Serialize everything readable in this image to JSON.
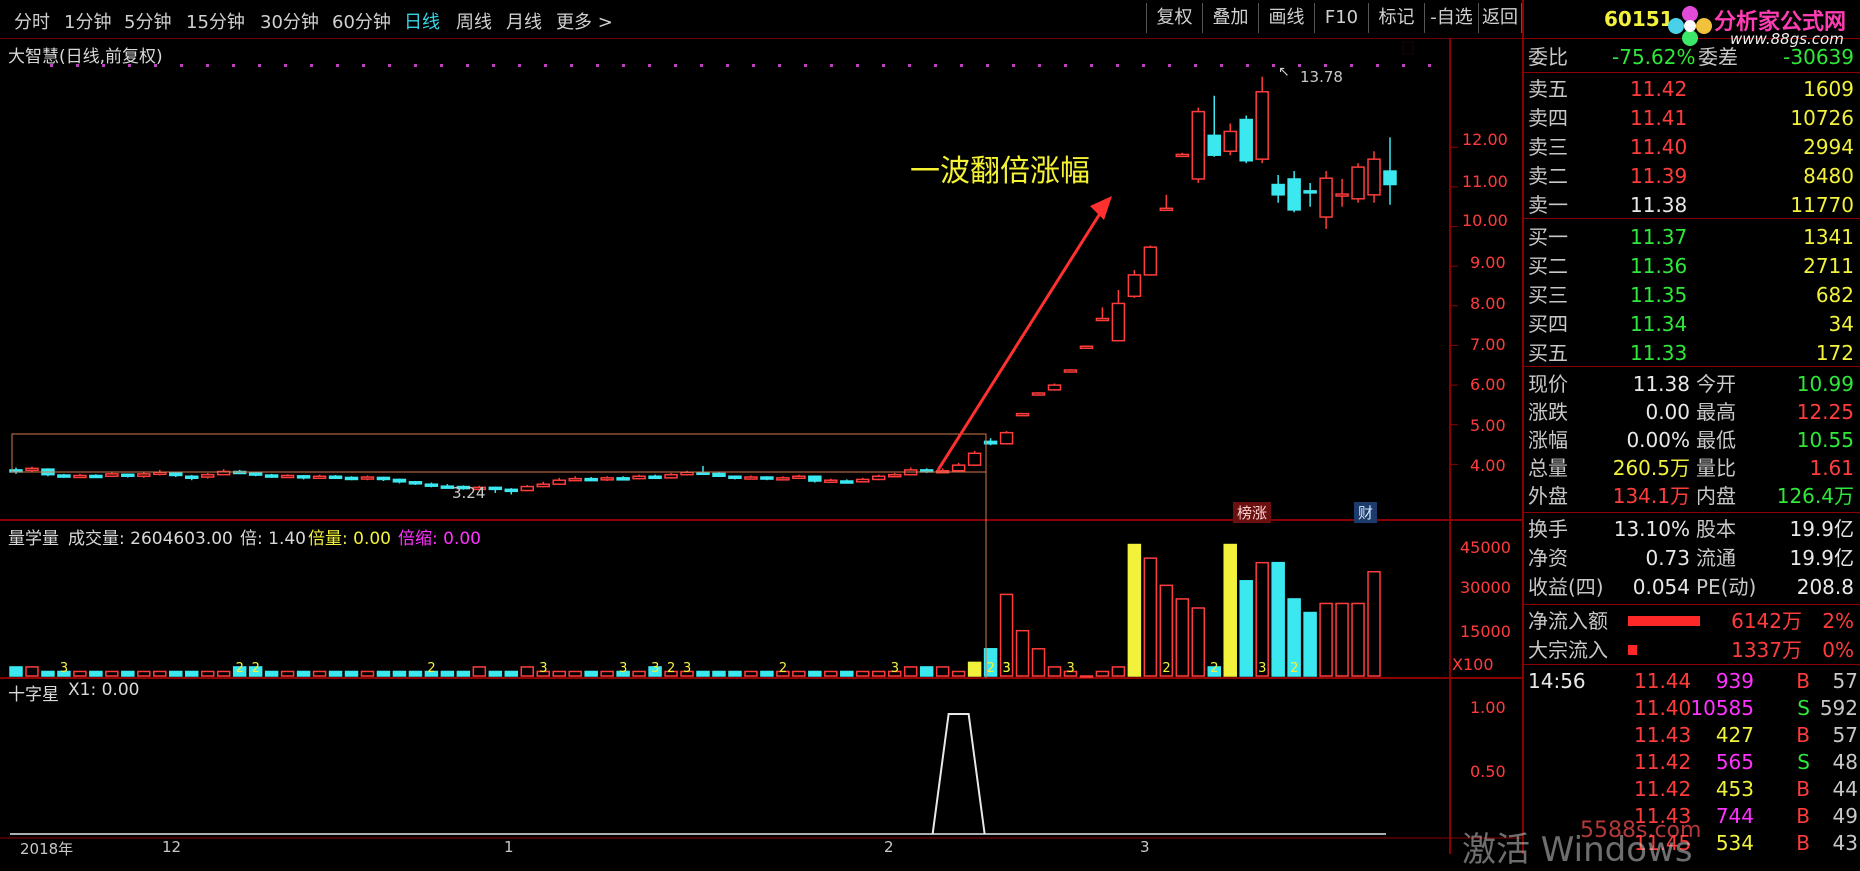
{
  "periods": [
    "分时",
    "1分钟",
    "5分钟",
    "15分钟",
    "30分钟",
    "60分钟",
    "日线",
    "周线",
    "月线",
    "更多 >"
  ],
  "active_period": "日线",
  "toolbar": [
    "复权",
    "叠加",
    "画线",
    "F10",
    "标记",
    "-自选",
    "返回"
  ],
  "stock_title": "大智慧(日线,前复权)",
  "annotation": "一波翻倍涨幅",
  "high_label": "13.78",
  "low_label": "3.24",
  "price_axis": [
    "12.00",
    "11.00",
    "10.00",
    "9.00",
    "8.00",
    "7.00",
    "6.00",
    "5.00",
    "4.00"
  ],
  "badges": {
    "bangzhang": "榜涨",
    "cai": "财"
  },
  "vol_header": {
    "name": "量学量",
    "vol_label": "成交量: 2604603.00",
    "bei_label": "倍: 1.40",
    "beiliang_label": "倍量: 0.00",
    "beisuo_label": "倍缩: 0.00"
  },
  "vol_axis": [
    "45000",
    "30000",
    "15000"
  ],
  "vol_unit": "X100",
  "vol_digits": [
    "3",
    "2",
    "2",
    "2",
    "3",
    "3",
    "3",
    "2",
    "3",
    "2",
    "3",
    "2",
    "2",
    "3",
    "3",
    "2",
    "2",
    "3",
    "2",
    "3"
  ],
  "ind_header": {
    "name": "十字星",
    "x1": "X1: 0.00"
  },
  "ind_axis": [
    "1.00",
    "0.50"
  ],
  "date_axis": [
    "2018年",
    "12",
    "1",
    "2",
    "3"
  ],
  "watermark": {
    "activate": "激活 Windows",
    "site": "5588s.com"
  },
  "panel": {
    "code": "60151",
    "logo_text": "分析家公式网",
    "logo_url": "www.88gs.com",
    "weibi_label": "委比",
    "weibi_value": "-75.62%",
    "weicha_label": "委差",
    "weicha_value": "-30639",
    "asks": [
      {
        "label": "卖五",
        "price": "11.42",
        "vol": "1609"
      },
      {
        "label": "卖四",
        "price": "11.41",
        "vol": "10726"
      },
      {
        "label": "卖三",
        "price": "11.40",
        "vol": "2994"
      },
      {
        "label": "卖二",
        "price": "11.39",
        "vol": "8480"
      },
      {
        "label": "卖一",
        "price": "11.38",
        "vol": "11770"
      }
    ],
    "bids": [
      {
        "label": "买一",
        "price": "11.37",
        "vol": "1341"
      },
      {
        "label": "买二",
        "price": "11.36",
        "vol": "2711"
      },
      {
        "label": "买三",
        "price": "11.35",
        "vol": "682"
      },
      {
        "label": "买四",
        "price": "11.34",
        "vol": "34"
      },
      {
        "label": "买五",
        "price": "11.33",
        "vol": "172"
      }
    ],
    "quote": [
      {
        "l1": "现价",
        "v1": "11.38",
        "c1": "white",
        "l2": "今开",
        "v2": "10.99",
        "c2": "green"
      },
      {
        "l1": "涨跌",
        "v1": "0.00",
        "c1": "white",
        "l2": "最高",
        "v2": "12.25",
        "c2": "red"
      },
      {
        "l1": "涨幅",
        "v1": "0.00%",
        "c1": "white",
        "l2": "最低",
        "v2": "10.55",
        "c2": "green"
      },
      {
        "l1": "总量",
        "v1": "260.5万",
        "c1": "yellow",
        "l2": "量比",
        "v2": "1.61",
        "c2": "red"
      },
      {
        "l1": "外盘",
        "v1": "134.1万",
        "c1": "red",
        "l2": "内盘",
        "v2": "126.4万",
        "c2": "green"
      }
    ],
    "stats": [
      {
        "l1": "换手",
        "v1": "13.10%",
        "l2": "股本",
        "v2": "19.9亿"
      },
      {
        "l1": "净资",
        "v1": "0.73",
        "l2": "流通",
        "v2": "19.9亿"
      },
      {
        "l1": "收益(四)",
        "v1": "0.054",
        "l2": "PE(动)",
        "v2": "208.8"
      }
    ],
    "flows": [
      {
        "label": "净流入额",
        "value": "6142万",
        "pct": "2%",
        "bar": 0.8
      },
      {
        "label": "大宗流入",
        "value": "1337万",
        "pct": "0%",
        "bar": 0.1
      }
    ],
    "ticks": [
      {
        "time": "14:56",
        "price": "11.44",
        "vol": "939",
        "side": "B",
        "n": "57",
        "vc": "magenta"
      },
      {
        "time": "",
        "price": "11.40",
        "vol": "10585",
        "side": "S",
        "n": "592",
        "vc": "magenta"
      },
      {
        "time": "",
        "price": "11.43",
        "vol": "427",
        "side": "B",
        "n": "57",
        "vc": "yellow"
      },
      {
        "time": "",
        "price": "11.42",
        "vol": "565",
        "side": "S",
        "n": "48",
        "vc": "magenta"
      },
      {
        "time": "",
        "price": "11.42",
        "vol": "453",
        "side": "B",
        "n": "44",
        "vc": "yellow"
      },
      {
        "time": "",
        "price": "11.43",
        "vol": "744",
        "side": "B",
        "n": "49",
        "vc": "magenta"
      },
      {
        "time": "",
        "price": "11.45",
        "vol": "534",
        "side": "B",
        "n": "43",
        "vc": "yellow"
      }
    ]
  },
  "chart_data": {
    "type": "candlestick",
    "price_axis_range": [
      3.0,
      14.0
    ],
    "series": [
      {
        "o": 3.86,
        "c": 3.82,
        "h": 3.92,
        "l": 3.76
      },
      {
        "o": 3.85,
        "c": 3.9,
        "h": 3.94,
        "l": 3.82
      },
      {
        "o": 3.88,
        "c": 3.74,
        "h": 3.9,
        "l": 3.7
      },
      {
        "o": 3.73,
        "c": 3.7,
        "h": 3.76,
        "l": 3.66
      },
      {
        "o": 3.71,
        "c": 3.72,
        "h": 3.76,
        "l": 3.68
      },
      {
        "o": 3.72,
        "c": 3.69,
        "h": 3.75,
        "l": 3.66
      },
      {
        "o": 3.7,
        "c": 3.76,
        "h": 3.8,
        "l": 3.68
      },
      {
        "o": 3.75,
        "c": 3.7,
        "h": 3.77,
        "l": 3.67
      },
      {
        "o": 3.7,
        "c": 3.76,
        "h": 3.8,
        "l": 3.66
      },
      {
        "o": 3.76,
        "c": 3.8,
        "h": 3.86,
        "l": 3.72
      },
      {
        "o": 3.79,
        "c": 3.72,
        "h": 3.82,
        "l": 3.68
      },
      {
        "o": 3.7,
        "c": 3.66,
        "h": 3.73,
        "l": 3.6
      },
      {
        "o": 3.68,
        "c": 3.74,
        "h": 3.78,
        "l": 3.64
      },
      {
        "o": 3.74,
        "c": 3.82,
        "h": 3.88,
        "l": 3.72
      },
      {
        "o": 3.82,
        "c": 3.79,
        "h": 3.86,
        "l": 3.76
      },
      {
        "o": 3.78,
        "c": 3.74,
        "h": 3.8,
        "l": 3.7
      },
      {
        "o": 3.73,
        "c": 3.7,
        "h": 3.76,
        "l": 3.66
      },
      {
        "o": 3.7,
        "c": 3.72,
        "h": 3.75,
        "l": 3.67
      },
      {
        "o": 3.71,
        "c": 3.66,
        "h": 3.73,
        "l": 3.62
      },
      {
        "o": 3.66,
        "c": 3.7,
        "h": 3.74,
        "l": 3.63
      },
      {
        "o": 3.7,
        "c": 3.68,
        "h": 3.73,
        "l": 3.64
      },
      {
        "o": 3.67,
        "c": 3.64,
        "h": 3.7,
        "l": 3.6
      },
      {
        "o": 3.64,
        "c": 3.68,
        "h": 3.72,
        "l": 3.6
      },
      {
        "o": 3.67,
        "c": 3.62,
        "h": 3.69,
        "l": 3.58
      },
      {
        "o": 3.62,
        "c": 3.56,
        "h": 3.64,
        "l": 3.52
      },
      {
        "o": 3.56,
        "c": 3.52,
        "h": 3.58,
        "l": 3.48
      },
      {
        "o": 3.5,
        "c": 3.46,
        "h": 3.54,
        "l": 3.42
      },
      {
        "o": 3.45,
        "c": 3.44,
        "h": 3.5,
        "l": 3.4
      },
      {
        "o": 3.44,
        "c": 3.4,
        "h": 3.47,
        "l": 3.36
      },
      {
        "o": 3.4,
        "c": 3.42,
        "h": 3.46,
        "l": 3.34
      },
      {
        "o": 3.42,
        "c": 3.38,
        "h": 3.44,
        "l": 3.28
      },
      {
        "o": 3.37,
        "c": 3.34,
        "h": 3.4,
        "l": 3.24
      },
      {
        "o": 3.34,
        "c": 3.44,
        "h": 3.48,
        "l": 3.32
      },
      {
        "o": 3.44,
        "c": 3.5,
        "h": 3.56,
        "l": 3.42
      },
      {
        "o": 3.5,
        "c": 3.6,
        "h": 3.66,
        "l": 3.48
      },
      {
        "o": 3.6,
        "c": 3.64,
        "h": 3.7,
        "l": 3.58
      },
      {
        "o": 3.64,
        "c": 3.62,
        "h": 3.68,
        "l": 3.58
      },
      {
        "o": 3.62,
        "c": 3.66,
        "h": 3.7,
        "l": 3.58
      },
      {
        "o": 3.66,
        "c": 3.64,
        "h": 3.7,
        "l": 3.6
      },
      {
        "o": 3.64,
        "c": 3.7,
        "h": 3.74,
        "l": 3.62
      },
      {
        "o": 3.7,
        "c": 3.66,
        "h": 3.74,
        "l": 3.64
      },
      {
        "o": 3.66,
        "c": 3.74,
        "h": 3.78,
        "l": 3.64
      },
      {
        "o": 3.74,
        "c": 3.8,
        "h": 3.84,
        "l": 3.72
      },
      {
        "o": 3.8,
        "c": 3.78,
        "h": 3.96,
        "l": 3.74
      },
      {
        "o": 3.77,
        "c": 3.7,
        "h": 3.8,
        "l": 3.68
      },
      {
        "o": 3.7,
        "c": 3.66,
        "h": 3.72,
        "l": 3.62
      },
      {
        "o": 3.66,
        "c": 3.68,
        "h": 3.72,
        "l": 3.62
      },
      {
        "o": 3.68,
        "c": 3.64,
        "h": 3.7,
        "l": 3.6
      },
      {
        "o": 3.64,
        "c": 3.66,
        "h": 3.7,
        "l": 3.6
      },
      {
        "o": 3.66,
        "c": 3.7,
        "h": 3.74,
        "l": 3.64
      },
      {
        "o": 3.7,
        "c": 3.58,
        "h": 3.72,
        "l": 3.54
      },
      {
        "o": 3.58,
        "c": 3.6,
        "h": 3.64,
        "l": 3.54
      },
      {
        "o": 3.58,
        "c": 3.56,
        "h": 3.62,
        "l": 3.52
      },
      {
        "o": 3.56,
        "c": 3.62,
        "h": 3.66,
        "l": 3.54
      },
      {
        "o": 3.62,
        "c": 3.7,
        "h": 3.74,
        "l": 3.6
      },
      {
        "o": 3.7,
        "c": 3.74,
        "h": 3.78,
        "l": 3.68
      },
      {
        "o": 3.74,
        "c": 3.86,
        "h": 3.92,
        "l": 3.72
      },
      {
        "o": 3.86,
        "c": 3.82,
        "h": 3.9,
        "l": 3.78
      },
      {
        "o": 3.82,
        "c": 3.84,
        "h": 3.9,
        "l": 3.8
      },
      {
        "o": 3.84,
        "c": 3.98,
        "h": 4.04,
        "l": 3.82
      },
      {
        "o": 3.98,
        "c": 4.28,
        "h": 4.34,
        "l": 3.96
      },
      {
        "o": 4.58,
        "c": 4.52,
        "h": 4.66,
        "l": 4.48
      },
      {
        "o": 4.52,
        "c": 4.8,
        "h": 4.84,
        "l": 4.5
      },
      {
        "o": 5.28,
        "c": 5.28,
        "h": 5.3,
        "l": 5.26
      },
      {
        "o": 5.8,
        "c": 5.8,
        "h": 5.82,
        "l": 5.78
      },
      {
        "o": 5.88,
        "c": 6.0,
        "h": 6.04,
        "l": 5.86
      },
      {
        "o": 6.38,
        "c": 6.38,
        "h": 6.4,
        "l": 6.36
      },
      {
        "o": 6.98,
        "c": 6.98,
        "h": 7.0,
        "l": 6.96
      },
      {
        "o": 7.68,
        "c": 7.68,
        "h": 7.96,
        "l": 7.66
      },
      {
        "o": 7.12,
        "c": 8.06,
        "h": 8.4,
        "l": 7.1
      },
      {
        "o": 8.24,
        "c": 8.78,
        "h": 8.9,
        "l": 8.2
      },
      {
        "o": 8.78,
        "c": 9.48,
        "h": 9.52,
        "l": 8.76
      },
      {
        "o": 10.46,
        "c": 10.46,
        "h": 10.8,
        "l": 10.44
      },
      {
        "o": 11.82,
        "c": 11.82,
        "h": 11.86,
        "l": 11.8
      },
      {
        "o": 11.2,
        "c": 12.9,
        "h": 13.0,
        "l": 11.1
      },
      {
        "o": 12.3,
        "c": 11.8,
        "h": 13.3,
        "l": 11.76
      },
      {
        "o": 11.9,
        "c": 12.4,
        "h": 12.6,
        "l": 11.8
      },
      {
        "o": 12.7,
        "c": 11.66,
        "h": 12.8,
        "l": 11.6
      },
      {
        "o": 11.7,
        "c": 13.4,
        "h": 13.78,
        "l": 11.6
      },
      {
        "o": 11.06,
        "c": 10.8,
        "h": 11.3,
        "l": 10.6
      },
      {
        "o": 11.2,
        "c": 10.42,
        "h": 11.4,
        "l": 10.36
      },
      {
        "o": 10.9,
        "c": 10.86,
        "h": 11.1,
        "l": 10.5
      },
      {
        "o": 10.24,
        "c": 11.22,
        "h": 11.4,
        "l": 9.94
      },
      {
        "o": 10.8,
        "c": 10.82,
        "h": 11.2,
        "l": 10.5
      },
      {
        "o": 10.7,
        "c": 11.5,
        "h": 11.6,
        "l": 10.6
      },
      {
        "o": 10.8,
        "c": 11.7,
        "h": 11.9,
        "l": 10.6
      },
      {
        "o": 11.4,
        "c": 11.06,
        "h": 12.25,
        "l": 10.55
      }
    ],
    "volume_pattern": [
      2,
      2,
      1,
      1,
      1,
      1,
      1,
      1,
      1,
      1,
      1,
      1,
      1,
      1,
      2,
      2,
      1,
      1,
      1,
      1,
      1,
      1,
      1,
      1,
      1,
      1,
      1,
      1,
      1,
      2,
      1,
      1,
      2,
      1,
      1,
      1,
      1,
      1,
      1,
      1,
      2,
      1,
      1,
      1,
      1,
      1,
      1,
      1,
      1,
      1,
      1,
      1,
      1,
      1,
      1,
      1,
      2,
      2,
      2,
      1,
      3,
      6,
      18,
      10,
      6,
      2,
      1,
      0,
      1,
      2,
      29,
      26,
      20,
      17,
      15,
      2,
      29,
      21,
      25,
      25,
      17,
      14,
      16,
      16,
      16,
      23
    ],
    "cross_star": [
      0,
      0,
      0,
      0,
      0,
      0,
      0,
      0,
      0,
      0,
      0,
      0,
      0,
      0,
      0,
      0,
      0,
      0,
      0,
      0,
      0,
      0,
      0,
      0,
      0,
      0,
      0,
      0,
      0,
      0,
      0,
      0,
      0,
      0,
      0,
      0,
      0,
      0,
      0,
      0,
      0,
      0,
      0,
      0,
      0,
      0,
      0,
      0,
      0,
      0,
      0,
      0,
      0,
      0,
      0,
      0,
      0,
      0,
      0,
      1,
      0,
      0,
      0,
      0,
      0,
      0,
      0,
      0,
      0,
      0,
      0,
      0,
      0,
      0,
      0,
      0,
      0,
      0,
      0,
      0,
      0,
      0,
      0,
      0,
      0,
      0
    ]
  }
}
